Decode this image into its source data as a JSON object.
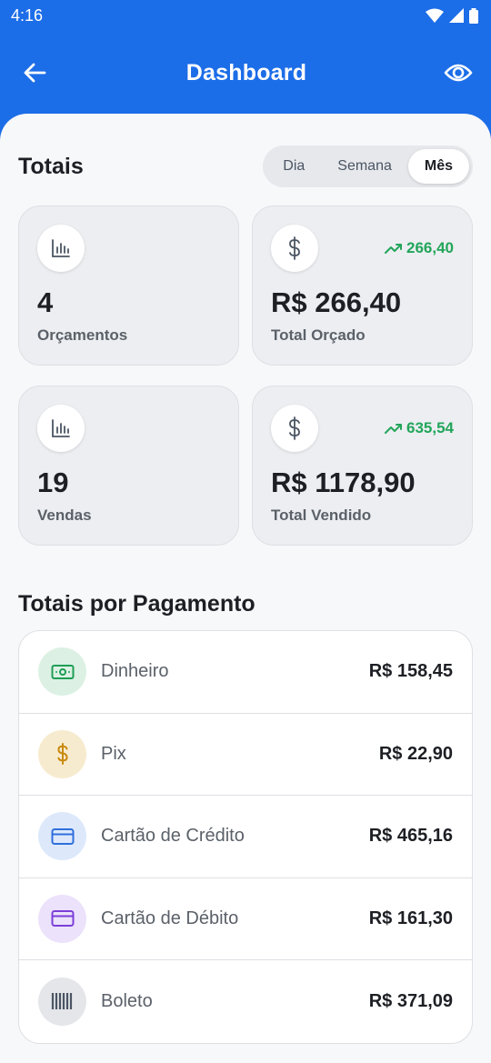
{
  "status": {
    "time": "4:16"
  },
  "appbar": {
    "title": "Dashboard"
  },
  "totals": {
    "title": "Totais",
    "periods": [
      "Dia",
      "Semana",
      "Mês"
    ],
    "selected_period": "Mês",
    "cards": [
      {
        "icon": "bar-chart-icon",
        "value": "4",
        "label": "Orçamentos",
        "trend": ""
      },
      {
        "icon": "dollar-icon",
        "value": "R$ 266,40",
        "label": "Total Orçado",
        "trend": "266,40"
      },
      {
        "icon": "bar-chart-icon",
        "value": "19",
        "label": "Vendas",
        "trend": ""
      },
      {
        "icon": "dollar-icon",
        "value": "R$ 1178,90",
        "label": "Total Vendido",
        "trend": "635,54"
      }
    ]
  },
  "payments": {
    "title": "Totais por Pagamento",
    "items": [
      {
        "icon": "cash-icon",
        "label": "Dinheiro",
        "amount": "R$ 158,45",
        "bg": "#dcf1e4",
        "color": "#1f9d55"
      },
      {
        "icon": "dollar-icon",
        "label": "Pix",
        "amount": "R$ 22,90",
        "bg": "#f7ebcf",
        "color": "#c98a0f"
      },
      {
        "icon": "credit-card-icon",
        "label": "Cartão de Crédito",
        "amount": "R$ 465,16",
        "bg": "#dde9fb",
        "color": "#2f6fdc"
      },
      {
        "icon": "debit-card-icon",
        "label": "Cartão de Débito",
        "amount": "R$ 161,30",
        "bg": "#ece2fb",
        "color": "#7b3fd8"
      },
      {
        "icon": "barcode-icon",
        "label": "Boleto",
        "amount": "R$ 371,09",
        "bg": "#e4e6e9",
        "color": "#4b5563"
      }
    ]
  },
  "colors": {
    "primary": "#1c6de8",
    "trend_green": "#22a55a"
  }
}
